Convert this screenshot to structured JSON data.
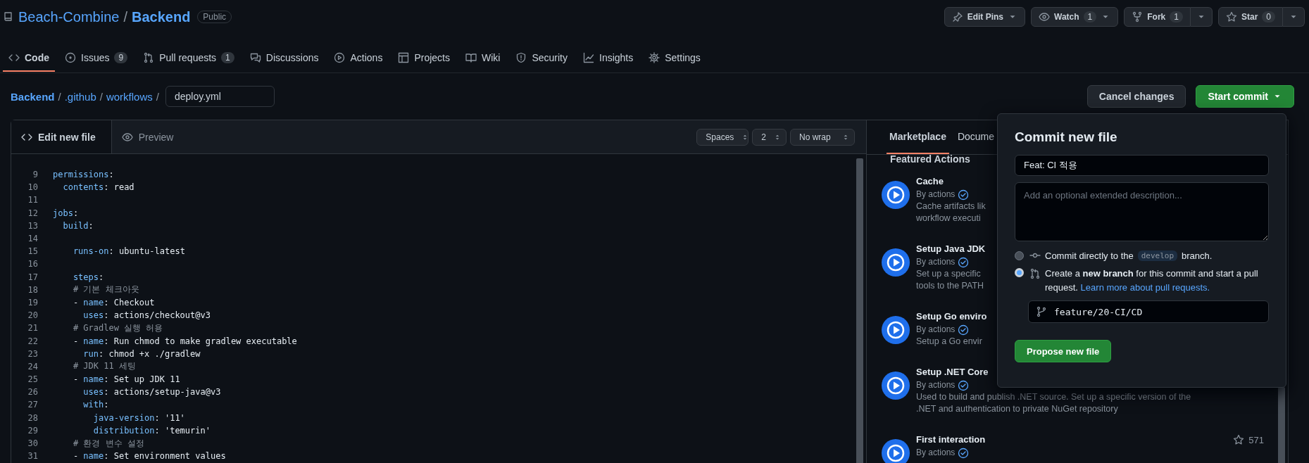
{
  "repo": {
    "owner": "Beach-Combine",
    "separator": "/",
    "name": "Backend",
    "visibility": "Public"
  },
  "repo_actions": [
    {
      "kind": "pin",
      "label": "Edit Pins"
    },
    {
      "kind": "watch",
      "label": "Watch",
      "count": "1"
    },
    {
      "kind": "fork",
      "label": "Fork",
      "count": "1"
    },
    {
      "kind": "star",
      "label": "Star",
      "count": "0"
    }
  ],
  "tabs": [
    {
      "kind": "code",
      "label": "Code",
      "selected": true
    },
    {
      "kind": "issues",
      "label": "Issues",
      "count": "9",
      "selected": false
    },
    {
      "kind": "pulls",
      "label": "Pull requests",
      "count": "1",
      "selected": false
    },
    {
      "kind": "discussions",
      "label": "Discussions",
      "selected": false
    },
    {
      "kind": "actions",
      "label": "Actions",
      "selected": false
    },
    {
      "kind": "projects",
      "label": "Projects",
      "selected": false
    },
    {
      "kind": "wiki",
      "label": "Wiki",
      "selected": false
    },
    {
      "kind": "security",
      "label": "Security",
      "selected": false
    },
    {
      "kind": "insights",
      "label": "Insights",
      "selected": false
    },
    {
      "kind": "settings",
      "label": "Settings",
      "selected": false
    }
  ],
  "breadcrumb": [
    {
      "kind": "repo",
      "label": "Backend"
    },
    {
      "kind": "separator",
      "label": "/"
    },
    {
      "kind": "dir",
      "label": ".github"
    },
    {
      "kind": "separator",
      "label": "/"
    },
    {
      "kind": "dir",
      "label": "workflows"
    },
    {
      "kind": "separator",
      "label": "/"
    }
  ],
  "filename": "deploy.yml",
  "cancel_button": "Cancel changes",
  "commit_button": "Start commit",
  "editor": {
    "tabs": [
      {
        "kind": "edit",
        "label": "Edit new file",
        "selected": true
      },
      {
        "kind": "preview",
        "label": "Preview",
        "selected": false
      }
    ],
    "selects": [
      "Spaces",
      "2",
      "No wrap"
    ],
    "lines": [
      {
        "number": "9",
        "tokens": [
          {
            "kind": "key",
            "text": "permissions"
          },
          {
            "kind": "plain",
            "text": ":"
          }
        ]
      },
      {
        "number": "10",
        "tokens": [
          {
            "kind": "key",
            "text": "  contents"
          },
          {
            "kind": "plain",
            "text": ": read"
          }
        ]
      },
      {
        "number": "11"
      },
      {
        "number": "12",
        "tokens": [
          {
            "kind": "key",
            "text": "jobs"
          },
          {
            "kind": "plain",
            "text": ":"
          }
        ]
      },
      {
        "number": "13",
        "tokens": [
          {
            "kind": "key",
            "text": "  build"
          },
          {
            "kind": "plain",
            "text": ":"
          }
        ]
      },
      {
        "number": "14"
      },
      {
        "number": "15",
        "tokens": [
          {
            "kind": "key",
            "text": "    runs-on"
          },
          {
            "kind": "plain",
            "text": ": ubuntu-latest"
          }
        ]
      },
      {
        "number": "16"
      },
      {
        "number": "17",
        "tokens": [
          {
            "kind": "key",
            "text": "    steps"
          },
          {
            "kind": "plain",
            "text": ":"
          }
        ]
      },
      {
        "number": "18",
        "tokens": [
          {
            "kind": "comment",
            "text": "    # 기본 체크아웃"
          }
        ]
      },
      {
        "number": "19",
        "tokens": [
          {
            "kind": "plain",
            "text": "    - "
          },
          {
            "kind": "key",
            "text": "name"
          },
          {
            "kind": "plain",
            "text": ": Checkout"
          }
        ]
      },
      {
        "number": "20",
        "tokens": [
          {
            "kind": "key",
            "text": "      uses"
          },
          {
            "kind": "plain",
            "text": ": actions/checkout@v3"
          }
        ]
      },
      {
        "number": "21",
        "tokens": [
          {
            "kind": "comment",
            "text": "    # Gradlew 실행 허용"
          }
        ]
      },
      {
        "number": "22",
        "tokens": [
          {
            "kind": "plain",
            "text": "    - "
          },
          {
            "kind": "key",
            "text": "name"
          },
          {
            "kind": "plain",
            "text": ": Run chmod to make gradlew executable"
          }
        ]
      },
      {
        "number": "23",
        "tokens": [
          {
            "kind": "key",
            "text": "      run"
          },
          {
            "kind": "plain",
            "text": ": chmod +x ./gradlew"
          }
        ]
      },
      {
        "number": "24",
        "tokens": [
          {
            "kind": "comment",
            "text": "    # JDK 11 세팅"
          }
        ]
      },
      {
        "number": "25",
        "tokens": [
          {
            "kind": "plain",
            "text": "    - "
          },
          {
            "kind": "key",
            "text": "name"
          },
          {
            "kind": "plain",
            "text": ": Set up JDK 11"
          }
        ]
      },
      {
        "number": "26",
        "tokens": [
          {
            "kind": "key",
            "text": "      uses"
          },
          {
            "kind": "plain",
            "text": ": actions/setup-java@v3"
          }
        ]
      },
      {
        "number": "27",
        "tokens": [
          {
            "kind": "key",
            "text": "      with"
          },
          {
            "kind": "plain",
            "text": ":"
          }
        ]
      },
      {
        "number": "28",
        "tokens": [
          {
            "kind": "key",
            "text": "        java-version"
          },
          {
            "kind": "plain",
            "text": ": '11'"
          }
        ]
      },
      {
        "number": "29",
        "tokens": [
          {
            "kind": "key",
            "text": "        distribution"
          },
          {
            "kind": "plain",
            "text": ": 'temurin'"
          }
        ]
      },
      {
        "number": "30",
        "tokens": [
          {
            "kind": "comment",
            "text": "    # 환경 변수 설정"
          }
        ]
      },
      {
        "number": "31",
        "tokens": [
          {
            "kind": "plain",
            "text": "    - "
          },
          {
            "kind": "key",
            "text": "name"
          },
          {
            "kind": "plain",
            "text": ": Set environment values"
          }
        ]
      }
    ]
  },
  "sidebar": {
    "tabs": [
      {
        "label": "Marketplace",
        "selected": true
      },
      {
        "label": "Docume",
        "selected": false
      }
    ],
    "heading": "Featured Actions",
    "actions": [
      {
        "title": "Cache",
        "publisher": "By actions",
        "description": [
          "Cache artifacts lik",
          "workflow executi"
        ]
      },
      {
        "title": "Setup Java JDK",
        "publisher": "By actions",
        "description": [
          "Set up a specific",
          "tools to the PATH"
        ]
      },
      {
        "title": "Setup Go enviro",
        "publisher": "By actions",
        "description": [
          "Setup a Go envir"
        ]
      },
      {
        "title": "Setup .NET Core",
        "publisher": "By actions",
        "description": [
          "Used to build and publish .NET source. Set up a specific version of the",
          ".NET and authentication to private NuGet repository"
        ]
      },
      {
        "title": "First interaction",
        "publisher": "By actions",
        "stars_count": "571"
      }
    ]
  },
  "commit_dialog": {
    "title": "Commit new file",
    "summary": "Feat: CI 적용",
    "description_placeholder": "Add an optional extended description...",
    "options": [
      {
        "kind": "direct",
        "selected": false,
        "text": "Commit directly to the",
        "branch": "develop",
        "text_after": "branch."
      },
      {
        "kind": "new_branch",
        "selected": true,
        "text": "Create a **new branch** for this commit and start a pull request.",
        "link": "Learn more about pull requests."
      }
    ],
    "branch_name": "feature/20-CI/CD",
    "submit": "Propose new file"
  }
}
